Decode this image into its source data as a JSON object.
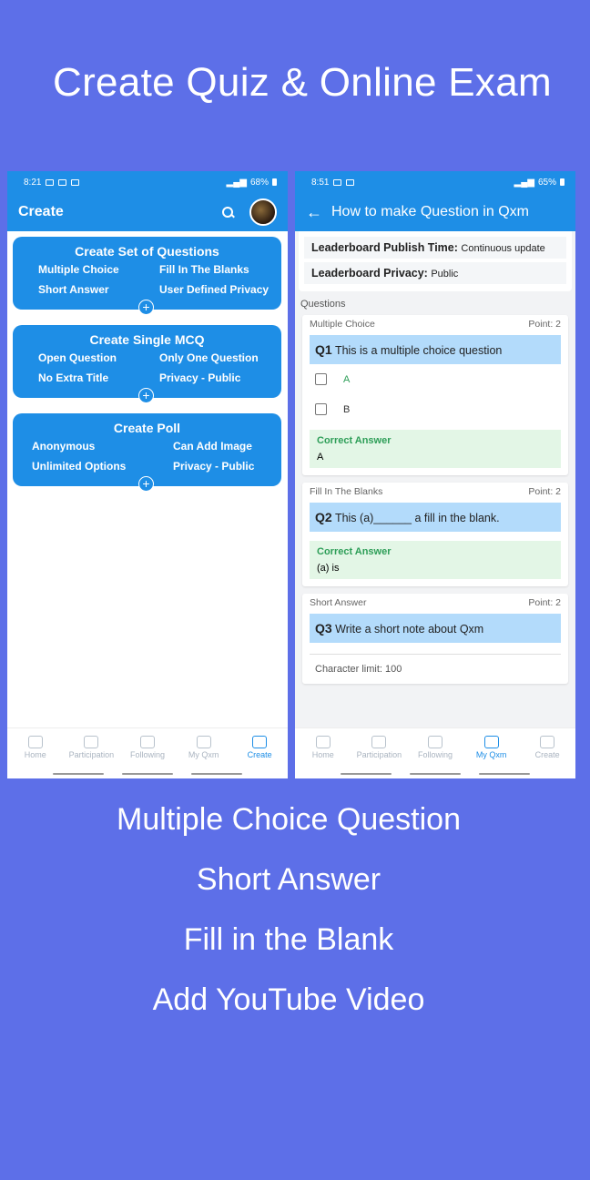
{
  "headline": "Create Quiz & Online Exam",
  "left_phone": {
    "status": {
      "time": "8:21",
      "battery": "68%"
    },
    "appbar_title": "Create",
    "cards": [
      {
        "title": "Create Set of Questions",
        "items": [
          "Multiple Choice",
          "Fill In The Blanks",
          "Short Answer",
          "User Defined Privacy"
        ]
      },
      {
        "title": "Create Single MCQ",
        "items": [
          "Open Question",
          "Only One Question",
          "No Extra Title",
          "Privacy - Public"
        ]
      },
      {
        "title": "Create Poll",
        "items": [
          "Anonymous",
          "Can Add Image",
          "Unlimited Options",
          "Privacy - Public"
        ]
      }
    ],
    "plus": "+",
    "nav": [
      "Home",
      "Participation",
      "Following",
      "My Qxm",
      "Create"
    ],
    "active_nav": "Create"
  },
  "right_phone": {
    "status": {
      "time": "8:51",
      "battery": "65%"
    },
    "appbar_title": "How to make Question in Qxm",
    "info": [
      {
        "label": "Leaderboard Publish Time:",
        "value": "Continuous update"
      },
      {
        "label": "Leaderboard Privacy:",
        "value": "Public"
      }
    ],
    "questions_label": "Questions",
    "q1": {
      "type": "Multiple Choice",
      "point": "Point: 2",
      "num": "Q1",
      "text": "This is a multiple choice question",
      "options": [
        "A",
        "B"
      ],
      "correct_label": "Correct Answer",
      "correct": "A"
    },
    "q2": {
      "type": "Fill In The Blanks",
      "point": "Point: 2",
      "num": "Q2",
      "text": "This (a)______ a fill in the blank.",
      "correct_label": "Correct Answer",
      "correct": "(a) is"
    },
    "q3": {
      "type": "Short Answer",
      "point": "Point: 2",
      "num": "Q3",
      "text": "Write a short note about Qxm",
      "char_limit": "Character limit: 100"
    },
    "nav": [
      "Home",
      "Participation",
      "Following",
      "My Qxm",
      "Create"
    ],
    "active_nav": "My Qxm"
  },
  "features": [
    "Multiple Choice Question",
    "Short Answer",
    "Fill in the Blank",
    "Add YouTube Video"
  ],
  "colors": {
    "background": "#5d6fe8",
    "primary": "#1e8ee6",
    "correct_green": "#2e9e58"
  }
}
